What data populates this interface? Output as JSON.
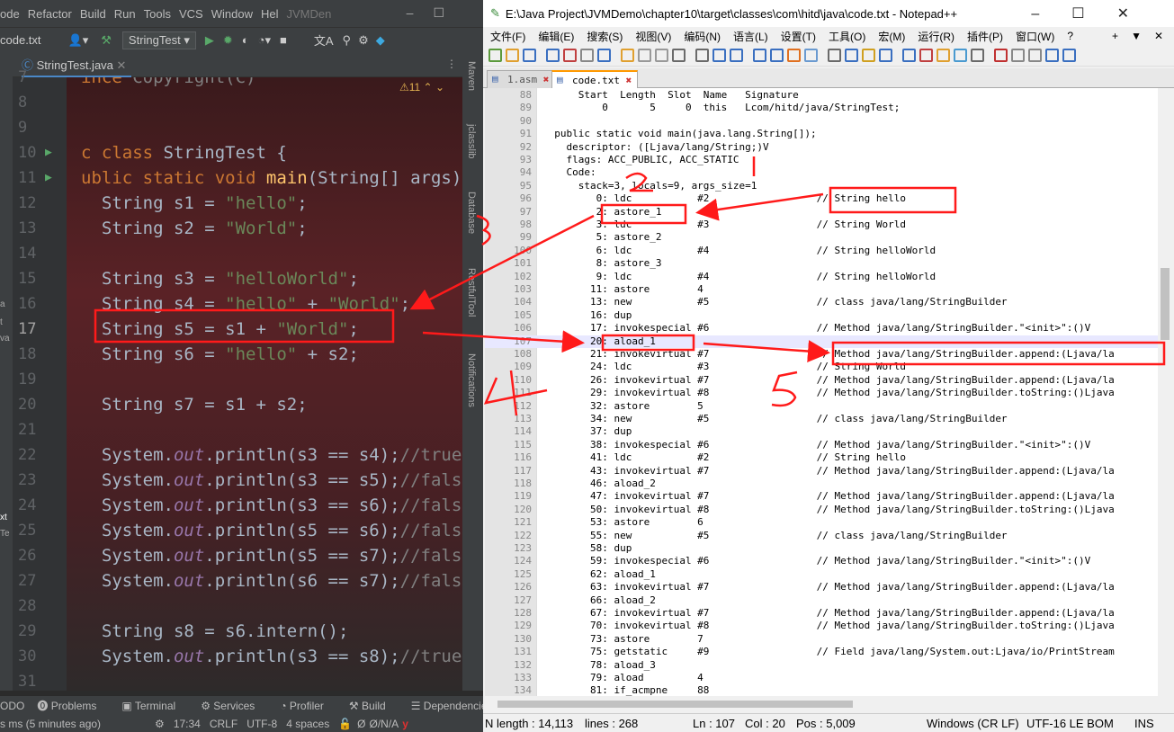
{
  "ide": {
    "menu": [
      "ode",
      "Refactor",
      "Build",
      "Run",
      "Tools",
      "VCS",
      "Window",
      "Hel"
    ],
    "project_name": "JVMDen",
    "file_crumb": "code.txt",
    "run_config": "StringTest",
    "tab": "StringTest.java",
    "warning_count": "11",
    "right_strip": [
      "Maven",
      "jclasslib",
      "Database",
      "RestfulTool",
      "Notifications"
    ],
    "left_strip": [
      "a",
      "t",
      "va",
      "xt",
      "Te"
    ],
    "code_lines": [
      {
        "n": "7",
        "html": "<span class=\"kw\">ince</span> <span class=\"cm\">Copyright(C)</span>"
      },
      {
        "n": "8",
        "html": ""
      },
      {
        "n": "9",
        "html": ""
      },
      {
        "n": "10",
        "html": "<span class=\"kw\">c class</span> StringTest {"
      },
      {
        "n": "11",
        "html": "<span class=\"kw\">ublic static void</span> <span class=\"fn\">main</span>(String[] args)"
      },
      {
        "n": "12",
        "html": "  String s1 = <span class=\"str\">\"hello\"</span>;"
      },
      {
        "n": "13",
        "html": "  String s2 = <span class=\"str\">\"World\"</span>;"
      },
      {
        "n": "14",
        "html": ""
      },
      {
        "n": "15",
        "html": "  String s3 = <span class=\"str\">\"helloWorld\"</span>;"
      },
      {
        "n": "16",
        "html": "  String s4 = <span class=\"str\">\"hello\"</span> + <span class=\"str\">\"World\"</span>;"
      },
      {
        "n": "17",
        "html": "  String s5 = s1 + <span class=\"str\">\"World\"</span>;"
      },
      {
        "n": "18",
        "html": "  String s6 = <span class=\"str\">\"hello\"</span> + s2;"
      },
      {
        "n": "19",
        "html": ""
      },
      {
        "n": "20",
        "html": "  String s7 = s1 + s2;"
      },
      {
        "n": "21",
        "html": ""
      },
      {
        "n": "22",
        "html": "  System.<span class=\"fld\">out</span>.println(s3 == s4);<span class=\"cm\">//true</span>"
      },
      {
        "n": "23",
        "html": "  System.<span class=\"fld\">out</span>.println(s3 == s5);<span class=\"cm\">//fals</span>"
      },
      {
        "n": "24",
        "html": "  System.<span class=\"fld\">out</span>.println(s3 == s6);<span class=\"cm\">//fals</span>"
      },
      {
        "n": "25",
        "html": "  System.<span class=\"fld\">out</span>.println(s5 == s6);<span class=\"cm\">//fals</span>"
      },
      {
        "n": "26",
        "html": "  System.<span class=\"fld\">out</span>.println(s5 == s7);<span class=\"cm\">//fals</span>"
      },
      {
        "n": "27",
        "html": "  System.<span class=\"fld\">out</span>.println(s6 == s7);<span class=\"cm\">//fals</span>"
      },
      {
        "n": "28",
        "html": ""
      },
      {
        "n": "29",
        "html": "  String s8 = s6.intern();"
      },
      {
        "n": "30",
        "html": "  System.<span class=\"fld\">out</span>.println(s3 == s8);<span class=\"cm\">//true</span>"
      },
      {
        "n": "31",
        "html": ""
      }
    ],
    "bottom_tabs": [
      "ODO",
      "Problems",
      "Terminal",
      "Services",
      "Profiler",
      "Build",
      "Dependencies"
    ],
    "status_left": "s ms (5 minutes ago)",
    "status_right": [
      "17:34",
      "CRLF",
      "UTF-8",
      "4 spaces",
      "Ø",
      "Ø/N/A"
    ]
  },
  "npp": {
    "title": "E:\\Java Project\\JVMDemo\\chapter10\\target\\classes\\com\\hitd\\java\\code.txt - Notepad++",
    "menu": [
      "文件(F)",
      "编辑(E)",
      "搜索(S)",
      "视图(V)",
      "编码(N)",
      "语言(L)",
      "设置(T)",
      "工具(O)",
      "宏(M)",
      "运行(R)",
      "插件(P)",
      "窗口(W)",
      "?"
    ],
    "tabs": [
      "1.asm",
      "code.txt"
    ],
    "lines": [
      {
        "n": "88",
        "t": "      Start  Length  Slot  Name   Signature"
      },
      {
        "n": "89",
        "t": "          0       5     0  this   Lcom/hitd/java/StringTest;"
      },
      {
        "n": "90",
        "t": ""
      },
      {
        "n": "91",
        "t": "  public static void main(java.lang.String[]);"
      },
      {
        "n": "92",
        "t": "    descriptor: ([Ljava/lang/String;)V"
      },
      {
        "n": "93",
        "t": "    flags: ACC_PUBLIC, ACC_STATIC"
      },
      {
        "n": "94",
        "t": "    Code:"
      },
      {
        "n": "95",
        "t": "      stack=3, locals=9, args_size=1"
      },
      {
        "n": "96",
        "t": "         0: ldc           #2                  // String hello"
      },
      {
        "n": "97",
        "t": "         2: astore_1"
      },
      {
        "n": "98",
        "t": "         3: ldc           #3                  // String World"
      },
      {
        "n": "99",
        "t": "         5: astore_2"
      },
      {
        "n": "100",
        "t": "         6: ldc           #4                  // String helloWorld"
      },
      {
        "n": "101",
        "t": "         8: astore_3"
      },
      {
        "n": "102",
        "t": "         9: ldc           #4                  // String helloWorld"
      },
      {
        "n": "103",
        "t": "        11: astore        4"
      },
      {
        "n": "104",
        "t": "        13: new           #5                  // class java/lang/StringBuilder"
      },
      {
        "n": "105",
        "t": "        16: dup"
      },
      {
        "n": "106",
        "t": "        17: invokespecial #6                  // Method java/lang/StringBuilder.\"<init>\":()V"
      },
      {
        "n": "107",
        "t": "        20: aload_1"
      },
      {
        "n": "108",
        "t": "        21: invokevirtual #7                  // Method java/lang/StringBuilder.append:(Ljava/la"
      },
      {
        "n": "109",
        "t": "        24: ldc           #3                  // String World"
      },
      {
        "n": "110",
        "t": "        26: invokevirtual #7                  // Method java/lang/StringBuilder.append:(Ljava/la"
      },
      {
        "n": "111",
        "t": "        29: invokevirtual #8                  // Method java/lang/StringBuilder.toString:()Ljava"
      },
      {
        "n": "112",
        "t": "        32: astore        5"
      },
      {
        "n": "113",
        "t": "        34: new           #5                  // class java/lang/StringBuilder"
      },
      {
        "n": "114",
        "t": "        37: dup"
      },
      {
        "n": "115",
        "t": "        38: invokespecial #6                  // Method java/lang/StringBuilder.\"<init>\":()V"
      },
      {
        "n": "116",
        "t": "        41: ldc           #2                  // String hello"
      },
      {
        "n": "117",
        "t": "        43: invokevirtual #7                  // Method java/lang/StringBuilder.append:(Ljava/la"
      },
      {
        "n": "118",
        "t": "        46: aload_2"
      },
      {
        "n": "119",
        "t": "        47: invokevirtual #7                  // Method java/lang/StringBuilder.append:(Ljava/la"
      },
      {
        "n": "120",
        "t": "        50: invokevirtual #8                  // Method java/lang/StringBuilder.toString:()Ljava"
      },
      {
        "n": "121",
        "t": "        53: astore        6"
      },
      {
        "n": "122",
        "t": "        55: new           #5                  // class java/lang/StringBuilder"
      },
      {
        "n": "123",
        "t": "        58: dup"
      },
      {
        "n": "124",
        "t": "        59: invokespecial #6                  // Method java/lang/StringBuilder.\"<init>\":()V"
      },
      {
        "n": "125",
        "t": "        62: aload_1"
      },
      {
        "n": "126",
        "t": "        63: invokevirtual #7                  // Method java/lang/StringBuilder.append:(Ljava/la"
      },
      {
        "n": "127",
        "t": "        66: aload_2"
      },
      {
        "n": "128",
        "t": "        67: invokevirtual #7                  // Method java/lang/StringBuilder.append:(Ljava/la"
      },
      {
        "n": "129",
        "t": "        70: invokevirtual #8                  // Method java/lang/StringBuilder.toString:()Ljava"
      },
      {
        "n": "130",
        "t": "        73: astore        7"
      },
      {
        "n": "131",
        "t": "        75: getstatic     #9                  // Field java/lang/System.out:Ljava/io/PrintStream"
      },
      {
        "n": "132",
        "t": "        78: aload_3"
      },
      {
        "n": "133",
        "t": "        79: aload         4"
      },
      {
        "n": "134",
        "t": "        81: if_acmpne     88"
      }
    ],
    "status": {
      "length": "N length : 14,113",
      "lines": "lines : 268",
      "ln": "Ln : 107",
      "col": "Col : 20",
      "pos": "Pos : 5,009",
      "eol": "Windows (CR LF)",
      "enc": "UTF-16 LE BOM",
      "mode": "INS"
    }
  },
  "annotations": [
    "1",
    "2",
    "3",
    "4",
    "5"
  ],
  "colors": {
    "accent": "#ff1a1a",
    "ide_bg": "#2b2b2b",
    "npp_current_line": "#e8e8ff"
  }
}
